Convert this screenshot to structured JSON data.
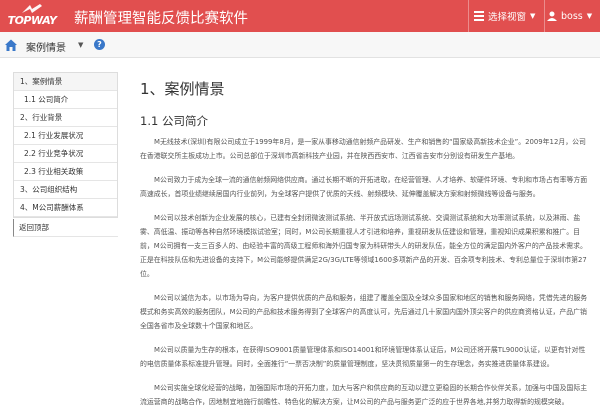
{
  "header": {
    "logo_text": "TOPWAY",
    "logo_caption": "拓维信息",
    "app_title": "薪酬管理智能反馈比赛软件",
    "view_select_label": "选择视窗",
    "user_name": "boss"
  },
  "breadcrumb": {
    "label": "案例情景"
  },
  "sidebar": {
    "items": [
      {
        "label": "1、案例情景"
      },
      {
        "label": "1.1 公司简介"
      },
      {
        "label": "2、行业背景"
      },
      {
        "label": "2.1 行业发展状况"
      },
      {
        "label": "2.2 行业竞争状况"
      },
      {
        "label": "2.3 行业相关政策"
      },
      {
        "label": "3、公司组织结构"
      },
      {
        "label": "4、M公司薪酬体系"
      }
    ],
    "back_label": "返回顶部"
  },
  "content": {
    "title": "1、案例情景",
    "subtitle": "1.1 公司简介",
    "paragraphs": [
      "M无线技术(深圳)有限公司成立于1999年8月，是一家从事移动通信射频产品研发、生产和销售的“国家级高新技术企业”。2009年12月，公司在香港联交所主板成功上市。公司总部位于深圳市高新科技产业园，并在陕西西安市、江西省吉安市分别设有研发生产基地。",
      "M公司致力于成为全球一流的通信射频网络供应商。通过长期不断的开拓进取，在经营管理、人才培养、软硬件环境、专利和市场占有率等方面高速成长，首项业绩继续居国内行业前列，为全球客户提供了优质的天线、射频模块、延伸覆盖解决方案和射频微线等设备与服务。",
      "M公司以技术创新为企业发展的核心，已建有全封闭微波测试系统、半开放式远场测试系统、交调测试系统和大功率测试系统，以及淋雨、盐雾、高低温、振动等各种自然环境模拟试验室；同时，M公司长期重视人才引进和培养，重视研发队伍建设和管理，重视知识成果积累和推广。目前，M公司拥有一支三百多人的、由经验丰富的高级工程师和海外归国专家为科研带头人的研发队伍，能全方位的满足国内外客户的产品技术需求。正是在科技队伍和先进设备的支持下，M公司能够提供满足2G/3G/LTE等领域1600多项新产品的开发、百余项专利技术、专利总量位于深圳市第27位。",
      "M公司以诚信为本，以市场为导向，为客户提供优质的产品和服务，组建了覆盖全国及全球众多国家和地区的销售和服务网络，凭借先进的服务模式和务实高效的服务团队，M公司的产品和技术服务得到了全球客户的高度认可，先后通过几十家国内国外顶尖客户的供应商资格认证，产品广销全国各省市及全球数十个国家和地区。",
      "M公司以质量为生存的根本，在获得ISO9001质量管理体系和ISO14001和环境管理体系认证后，M公司还将开展TL9000认证，以更有针对性的电信质量体系标准提升管理。同时，全面推行“一票否决制”的质量管理制度，坚决贯彻质量第一的生存理念，务实推进质量体系建设。",
      "M公司实施全球化经营的战略，加强国际市场的开拓力度，加大与客户和供应商的互动以建立更稳固的长期合作伙伴关系，加强与中国及国际主流运营商的战略合作，因地制宜地施行前瞻性、特色化的解决方案，让M公司的产品与服务更广泛的应于世界各地,并努力取得新的规模突破。"
    ]
  },
  "colors": {
    "header_bg": "#e14f4f",
    "help_icon": "#3a78c9"
  }
}
